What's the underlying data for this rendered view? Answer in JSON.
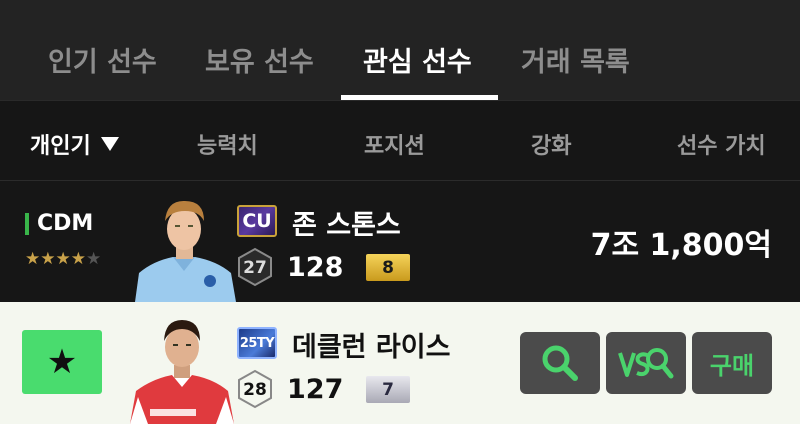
{
  "tabs": [
    {
      "label": "인기 선수",
      "active": false
    },
    {
      "label": "보유 선수",
      "active": false
    },
    {
      "label": "관심 선수",
      "active": true
    },
    {
      "label": "거래 목록",
      "active": false
    }
  ],
  "sort": {
    "options": [
      "개인기",
      "능력치",
      "포지션",
      "강화",
      "선수 가치"
    ],
    "selected": "개인기"
  },
  "players": [
    {
      "position": "CDM",
      "stars": 4,
      "max_stars": 5,
      "season_badge": "CU",
      "name": "존 스톤스",
      "pay": "27",
      "ovr": "128",
      "level": "8",
      "price": "7조 1,800억"
    },
    {
      "season_badge": "25TY",
      "name": "데클런 라이스",
      "pay": "28",
      "ovr": "127",
      "level": "7",
      "favorite_icon": "star-icon",
      "buy_label": "구매"
    }
  ],
  "colors": {
    "accent_green": "#4ad36c",
    "favorite_bg": "#49dc6e",
    "position_bar": "#39b54a",
    "star_gold": "#c9a24a"
  }
}
